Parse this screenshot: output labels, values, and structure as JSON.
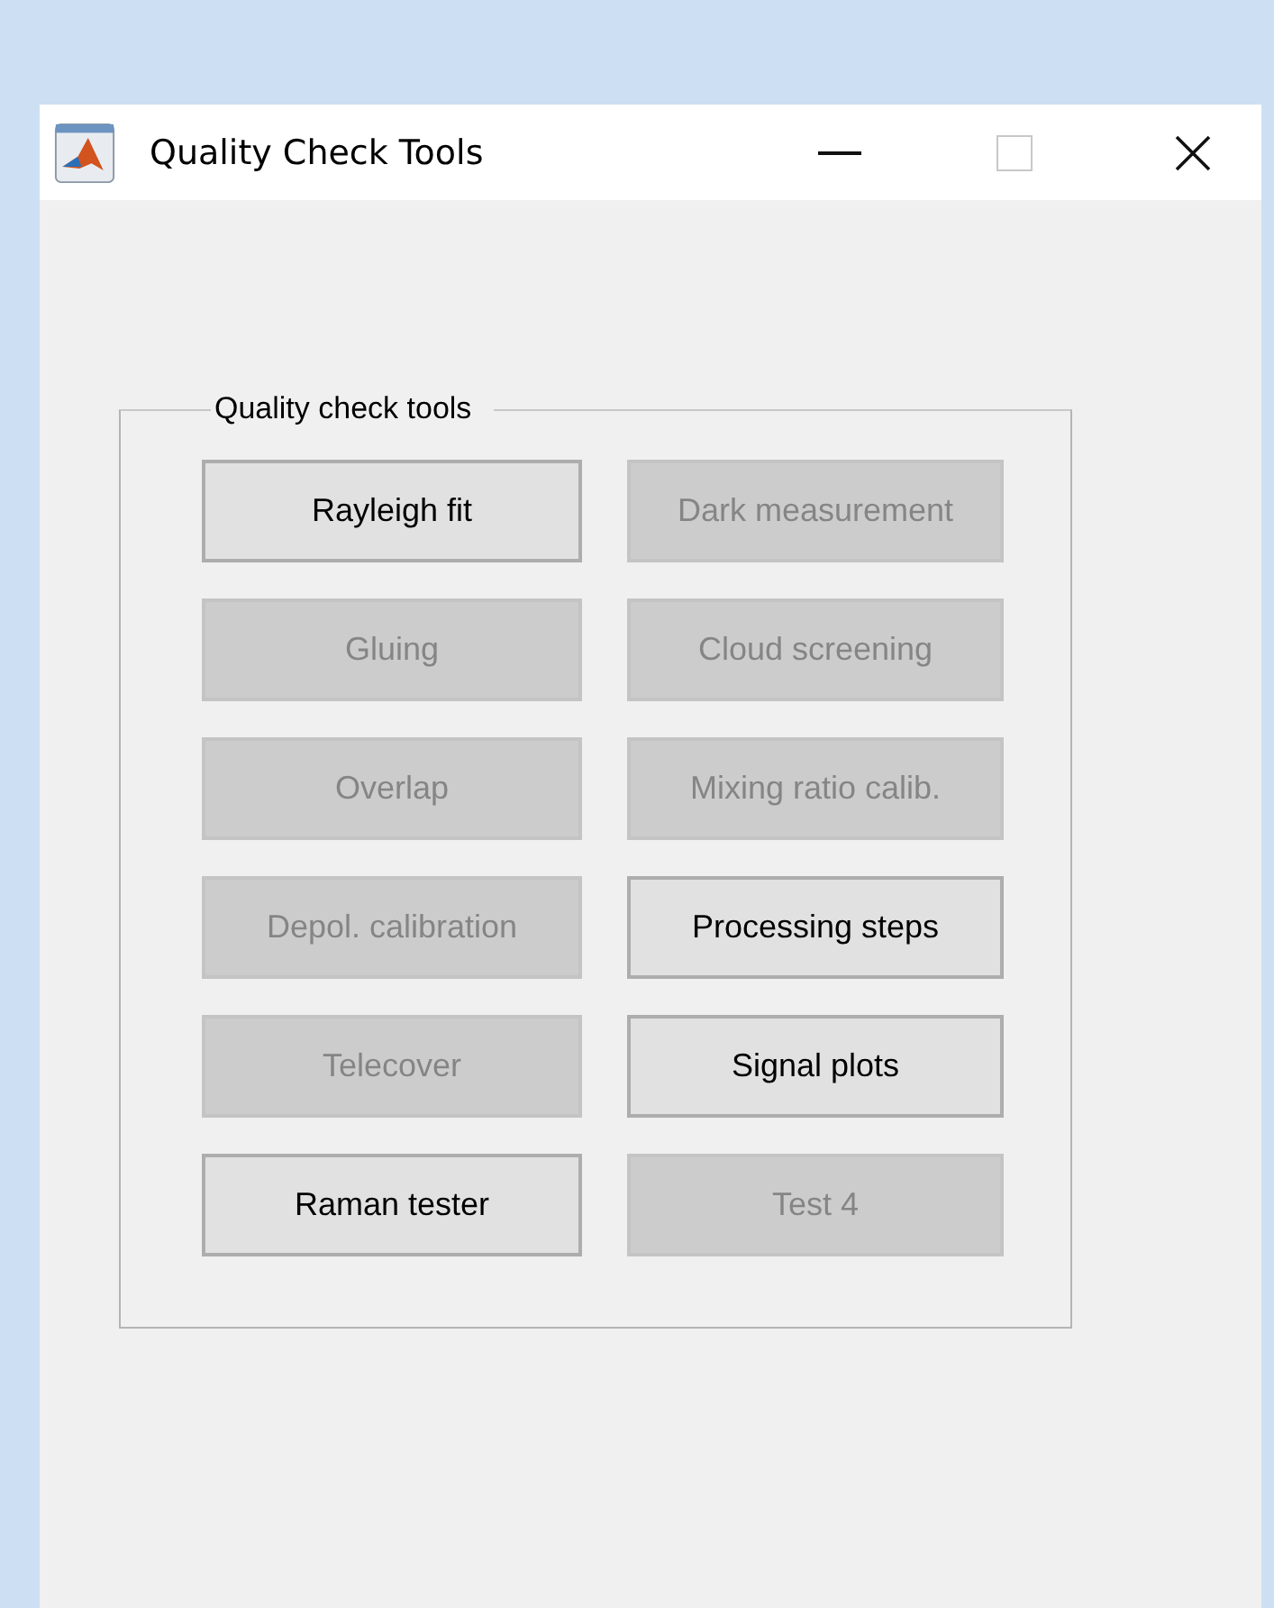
{
  "window": {
    "title": "Quality Check Tools"
  },
  "group": {
    "title": "Quality check tools"
  },
  "buttons": [
    {
      "label": "Rayleigh fit",
      "disabled": false
    },
    {
      "label": "Dark measurement",
      "disabled": true
    },
    {
      "label": "Gluing",
      "disabled": true
    },
    {
      "label": "Cloud screening",
      "disabled": true
    },
    {
      "label": "Overlap",
      "disabled": true
    },
    {
      "label": "Mixing ratio calib.",
      "disabled": true
    },
    {
      "label": "Depol. calibration",
      "disabled": true
    },
    {
      "label": "Processing steps",
      "disabled": false
    },
    {
      "label": "Telecover",
      "disabled": true
    },
    {
      "label": "Signal plots",
      "disabled": false
    },
    {
      "label": "Raman tester",
      "disabled": false
    },
    {
      "label": "Test 4",
      "disabled": true
    }
  ]
}
